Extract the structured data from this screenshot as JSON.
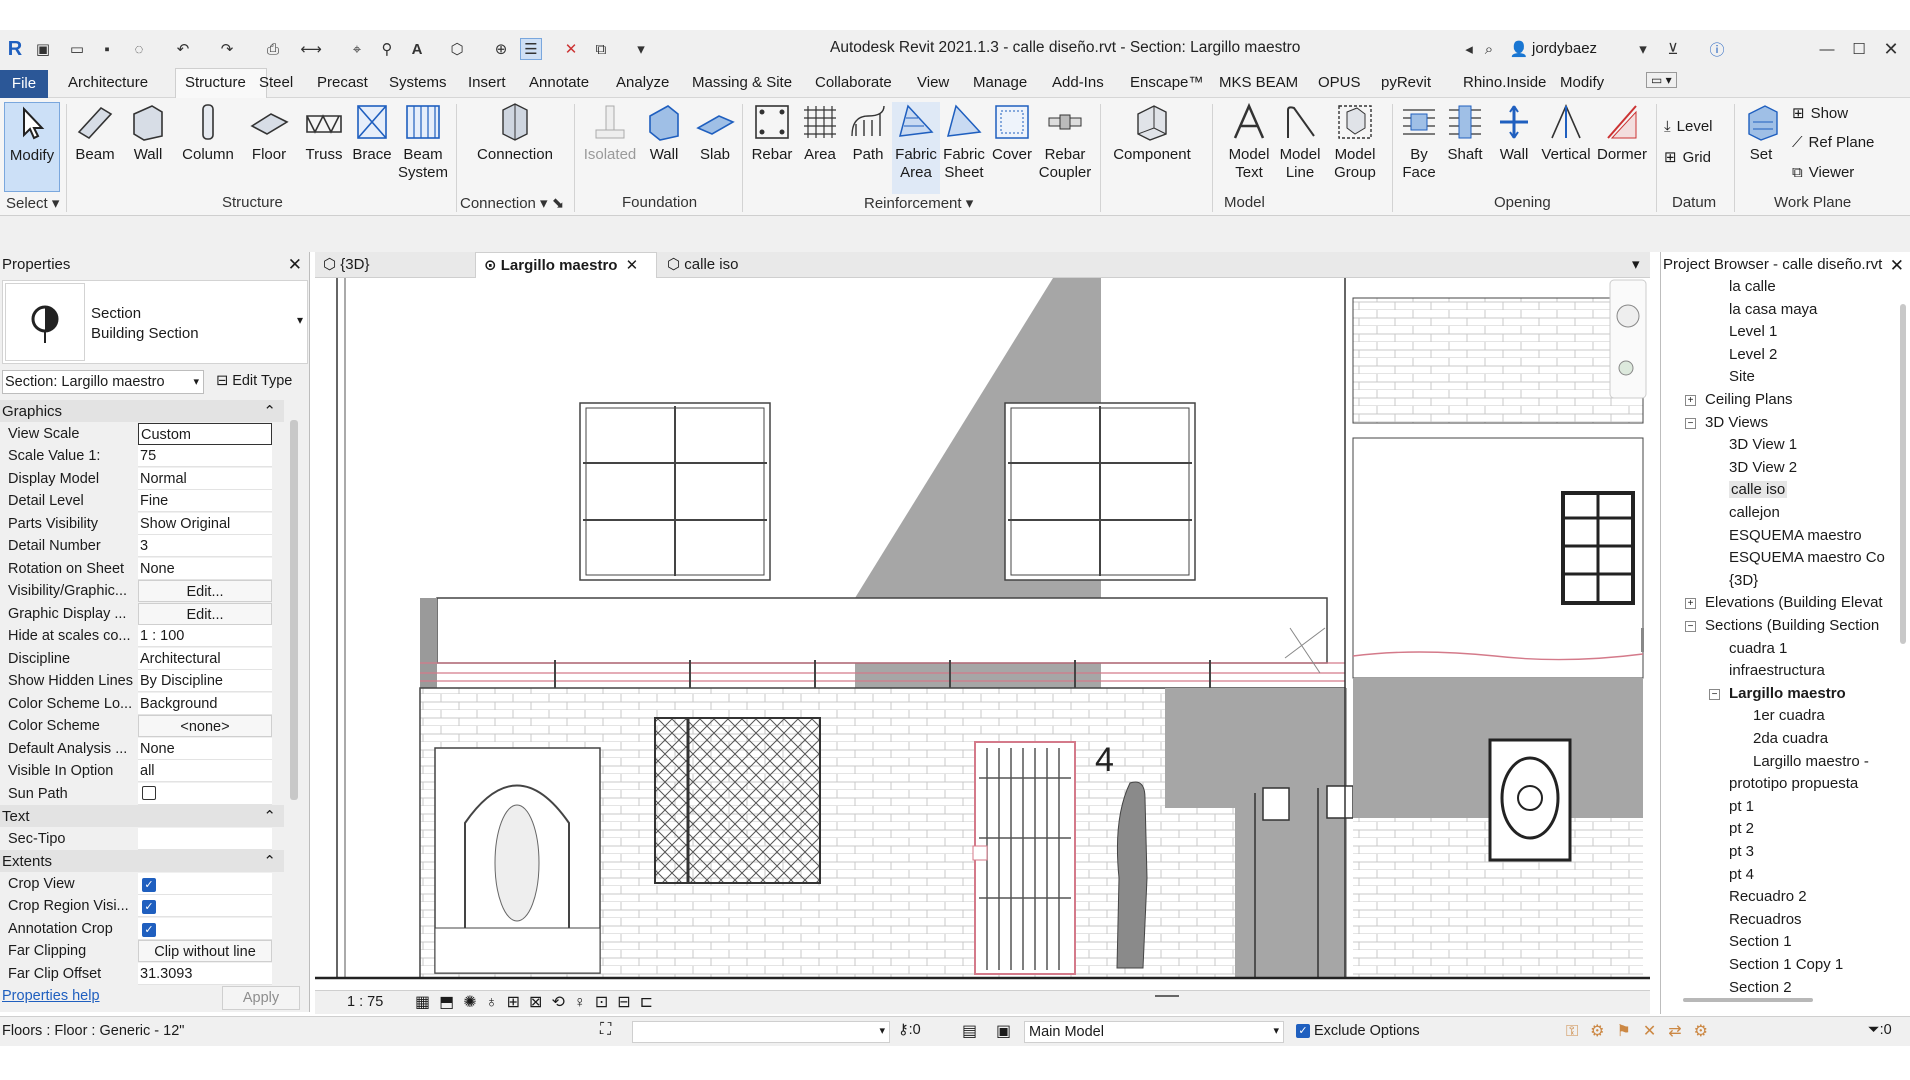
{
  "window": {
    "title": "Autodesk Revit 2021.1.3 - calle diseño.rvt - Section: Largillo maestro",
    "user": "jordybaez"
  },
  "menu": [
    "File",
    "Architecture",
    "Structure",
    "Steel",
    "Precast",
    "Systems",
    "Insert",
    "Annotate",
    "Analyze",
    "Massing & Site",
    "Collaborate",
    "View",
    "Manage",
    "Add-Ins",
    "Enscape™",
    "MKS BEAM",
    "OPUS",
    "pyRevit",
    "Rhino.Inside",
    "Modify"
  ],
  "ribbon": {
    "buttons": [
      "Modify",
      "Beam",
      "Wall",
      "Column",
      "Floor",
      "Truss",
      "Brace",
      "Beam System",
      "Connection",
      "Isolated",
      "Wall",
      "Slab",
      "Rebar",
      "Area",
      "Path",
      "Fabric Area",
      "Fabric Sheet",
      "Cover",
      "Rebar Coupler",
      "Component",
      "Model Text",
      "Model Line",
      "Model Group",
      "By Face",
      "Shaft",
      "Wall",
      "Vertical",
      "Dormer",
      "Set"
    ],
    "small": [
      "Level",
      "Grid",
      "Show",
      "Ref Plane",
      "Viewer"
    ],
    "panels": [
      "Select",
      "Structure",
      "Connection",
      "Foundation",
      "Reinforcement",
      "Model",
      "Opening",
      "Datum",
      "Work Plane"
    ]
  },
  "properties": {
    "header": "Properties",
    "type_name": "Section",
    "type_sub": "Building Section",
    "selector": "Section: Largillo maestro",
    "edit_type": "Edit Type",
    "groups": [
      "Graphics",
      "Text",
      "Extents"
    ],
    "rows": [
      {
        "k": "View Scale",
        "v": "Custom"
      },
      {
        "k": "Scale Value    1:",
        "v": "75"
      },
      {
        "k": "Display Model",
        "v": "Normal"
      },
      {
        "k": "Detail Level",
        "v": "Fine"
      },
      {
        "k": "Parts Visibility",
        "v": "Show Original"
      },
      {
        "k": "Detail Number",
        "v": "3"
      },
      {
        "k": "Rotation on Sheet",
        "v": "None"
      },
      {
        "k": "Visibility/Graphic...",
        "v": "Edit..."
      },
      {
        "k": "Graphic Display ...",
        "v": "Edit..."
      },
      {
        "k": "Hide at scales co...",
        "v": "1 : 100"
      },
      {
        "k": "Discipline",
        "v": "Architectural"
      },
      {
        "k": "Show Hidden Lines",
        "v": "By Discipline"
      },
      {
        "k": "Color Scheme Lo...",
        "v": "Background"
      },
      {
        "k": "Color Scheme",
        "v": "<none>"
      },
      {
        "k": "Default Analysis ...",
        "v": "None"
      },
      {
        "k": "Visible In Option",
        "v": "all"
      },
      {
        "k": "Sun Path",
        "v": ""
      }
    ],
    "text_rows": [
      {
        "k": "Sec-Tipo",
        "v": ""
      }
    ],
    "extent_rows": [
      {
        "k": "Crop View",
        "v": ""
      },
      {
        "k": "Crop Region Visi...",
        "v": ""
      },
      {
        "k": "Annotation Crop",
        "v": ""
      },
      {
        "k": "Far Clipping",
        "v": "Clip without line"
      },
      {
        "k": "Far Clip Offset",
        "v": "31.3093"
      }
    ],
    "help": "Properties help",
    "apply": "Apply"
  },
  "tabs": [
    {
      "label": "{3D}"
    },
    {
      "label": "Largillo maestro"
    },
    {
      "label": "calle iso"
    }
  ],
  "view": {
    "scale": "1 : 75",
    "grid_label": "4"
  },
  "browser": {
    "header": "Project Browser - calle diseño.rvt",
    "items": [
      {
        "t": "la calle",
        "l": 2
      },
      {
        "t": "la casa maya",
        "l": 2
      },
      {
        "t": "Level 1",
        "l": 2
      },
      {
        "t": "Level 2",
        "l": 2
      },
      {
        "t": "Site",
        "l": 2
      },
      {
        "t": "Ceiling Plans",
        "l": 1,
        "e": "+"
      },
      {
        "t": "3D Views",
        "l": 1,
        "e": "−"
      },
      {
        "t": "3D View 1",
        "l": 2
      },
      {
        "t": "3D View 2",
        "l": 2
      },
      {
        "t": "calle iso",
        "l": 2,
        "sel": true
      },
      {
        "t": "callejon",
        "l": 2
      },
      {
        "t": "ESQUEMA maestro",
        "l": 2
      },
      {
        "t": "ESQUEMA maestro Co",
        "l": 2
      },
      {
        "t": "{3D}",
        "l": 2
      },
      {
        "t": "Elevations (Building Elevat",
        "l": 1,
        "e": "+"
      },
      {
        "t": "Sections (Building Section",
        "l": 1,
        "e": "−"
      },
      {
        "t": "cuadra 1",
        "l": 2
      },
      {
        "t": "infraestructura",
        "l": 2
      },
      {
        "t": "Largillo maestro",
        "l": 2,
        "e": "−",
        "bold": true
      },
      {
        "t": "1er cuadra",
        "l": 3
      },
      {
        "t": "2da cuadra",
        "l": 3
      },
      {
        "t": "Largillo maestro -",
        "l": 3
      },
      {
        "t": "prototipo propuesta",
        "l": 2
      },
      {
        "t": "pt 1",
        "l": 2
      },
      {
        "t": "pt 2",
        "l": 2
      },
      {
        "t": "pt 3",
        "l": 2
      },
      {
        "t": "pt 4",
        "l": 2
      },
      {
        "t": "Recuadro 2",
        "l": 2
      },
      {
        "t": "Recuadros",
        "l": 2
      },
      {
        "t": "Section 1",
        "l": 2
      },
      {
        "t": "Section 1 Copy 1",
        "l": 2
      },
      {
        "t": "Section 2",
        "l": 2
      }
    ]
  },
  "status": {
    "left": "Floors : Floor : Generic - 12\"",
    "zero": ":0",
    "model": "Main Model",
    "exclude": "Exclude Options",
    "filter": ":0"
  }
}
